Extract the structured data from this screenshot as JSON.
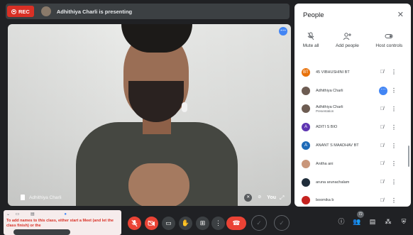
{
  "topbar": {
    "rec_label": "REC",
    "presenting_text": "Adhithiya Charli is presenting"
  },
  "video": {
    "name_label": "Adhithiya Charli",
    "self_label": "You"
  },
  "people_panel": {
    "title": "People",
    "actions": [
      {
        "label": "Mute all",
        "icon": "mic-off-icon"
      },
      {
        "label": "Add people",
        "icon": "add-person-icon"
      },
      {
        "label": "Host controls",
        "icon": "toggle-icon"
      }
    ],
    "participants": [
      {
        "initials": "BT",
        "name": "45 VIBHUSHINI BT",
        "sub": "",
        "avatar_color": "#e8710a",
        "status": "muted"
      },
      {
        "initials": "",
        "name": "Adhithiya Charli",
        "sub": "",
        "avatar_color": "#6d5c52",
        "status": "speaking"
      },
      {
        "initials": "",
        "name": "Adhithiya Charli",
        "sub": "Presentation",
        "avatar_color": "#6d5c52",
        "status": "muted"
      },
      {
        "initials": "A",
        "name": "ADITI S BIO",
        "sub": "",
        "avatar_color": "#5e35b1",
        "status": "muted"
      },
      {
        "initials": "A",
        "name": "ANANT S MAADHAV BT",
        "sub": "",
        "avatar_color": "#1e6ab7",
        "status": "muted"
      },
      {
        "initials": "",
        "name": "Anitha ani",
        "sub": "",
        "avatar_color": "#c9967a",
        "status": "muted"
      },
      {
        "initials": "",
        "name": "aruna arunachalam",
        "sub": "",
        "avatar_color": "#1f2d3a",
        "status": "muted"
      },
      {
        "initials": "",
        "name": "boomika b",
        "sub": "",
        "avatar_color": "#c5221f",
        "status": "muted"
      }
    ]
  },
  "notice": {
    "text": "To add names to this class, either start a Meet (and let the class finish) or the"
  },
  "controls": {
    "people_count": "72"
  }
}
